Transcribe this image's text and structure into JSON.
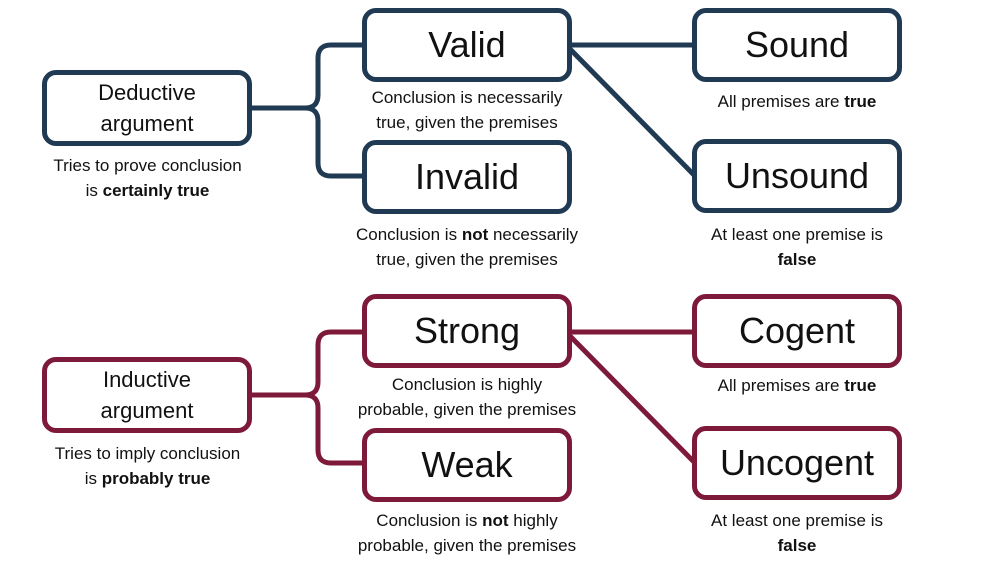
{
  "colors": {
    "deductive": "#1f3a52",
    "inductive": "#7d1a3a"
  },
  "deductive": {
    "root": {
      "line1": "Deductive",
      "line2": "argument",
      "caption_pre": "Tries to prove conclusion",
      "caption_is": "is ",
      "caption_bold": "certainly true"
    },
    "valid": {
      "label": "Valid",
      "caption_line1": "Conclusion is necessarily",
      "caption_line2": "true, given the premises"
    },
    "invalid": {
      "label": "Invalid",
      "caption_pre": "Conclusion is ",
      "caption_bold": "not",
      "caption_post": " necessarily",
      "caption_line2": "true, given the premises"
    },
    "sound": {
      "label": "Sound",
      "caption_pre": "All premises are ",
      "caption_bold": "true"
    },
    "unsound": {
      "label": "Unsound",
      "caption_line1": "At least one premise is",
      "caption_bold": "false"
    }
  },
  "inductive": {
    "root": {
      "line1": "Inductive",
      "line2": "argument",
      "caption_pre": "Tries to imply conclusion",
      "caption_is": "is ",
      "caption_bold": "probably true"
    },
    "strong": {
      "label": "Strong",
      "caption_line1": "Conclusion is highly",
      "caption_line2": "probable, given the premises"
    },
    "weak": {
      "label": "Weak",
      "caption_pre": "Conclusion is ",
      "caption_bold": "not",
      "caption_post": " highly",
      "caption_line2": "probable, given the premises"
    },
    "cogent": {
      "label": "Cogent",
      "caption_pre": "All premises are ",
      "caption_bold": "true"
    },
    "uncogent": {
      "label": "Uncogent",
      "caption_line1": "At least one premise is",
      "caption_bold": "false"
    }
  }
}
